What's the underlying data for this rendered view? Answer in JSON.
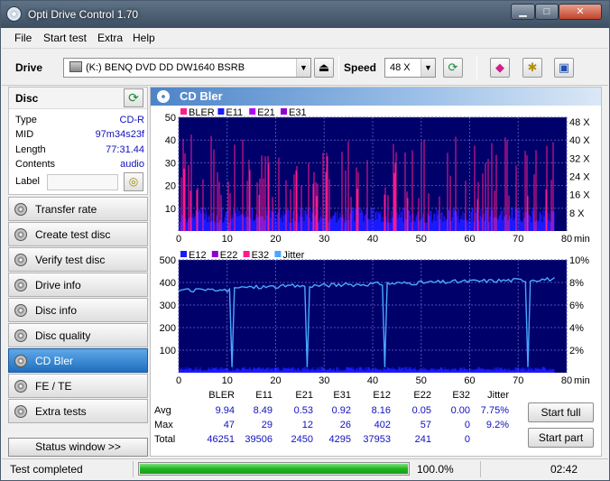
{
  "window": {
    "title": "Opti Drive Control 1.70"
  },
  "menu": [
    "File",
    "Start test",
    "Extra",
    "Help"
  ],
  "toolbar": {
    "drive_label": "Drive",
    "drive_value": "(K:)   BENQ DVD DD DW1640 BSRB",
    "speed_label": "Speed",
    "speed_value": "48 X"
  },
  "disc": {
    "title": "Disc",
    "rows": [
      {
        "key": "Type",
        "value": "CD-R"
      },
      {
        "key": "MID",
        "value": "97m34s23f"
      },
      {
        "key": "Length",
        "value": "77:31.44"
      },
      {
        "key": "Contents",
        "value": "audio"
      }
    ],
    "label_key": "Label"
  },
  "nav": [
    {
      "label": "Transfer rate",
      "active": false
    },
    {
      "label": "Create test disc",
      "active": false
    },
    {
      "label": "Verify test disc",
      "active": false
    },
    {
      "label": "Drive info",
      "active": false
    },
    {
      "label": "Disc info",
      "active": false
    },
    {
      "label": "Disc quality",
      "active": false
    },
    {
      "label": "CD Bler",
      "active": true
    },
    {
      "label": "FE / TE",
      "active": false
    },
    {
      "label": "Extra tests",
      "active": false
    }
  ],
  "status_window_label": "Status window >>",
  "main": {
    "title": "CD Bler"
  },
  "colors": {
    "chart_bg": "#00006a",
    "grid": "#5050b0",
    "bler": "#ff1a8c",
    "e11": "#1a1aff",
    "e21": "#b000ff",
    "e31": "#9000d0",
    "e12": "#1a1aff",
    "e22": "#9000d0",
    "e32": "#ff1a8c",
    "jitter": "#4aa8ff",
    "accent": "#1f6fc0"
  },
  "chart_data": [
    {
      "type": "bar",
      "legend": [
        "BLER",
        "E11",
        "E21",
        "E31"
      ],
      "x_ticks": [
        0,
        10,
        20,
        30,
        40,
        50,
        60,
        70,
        80
      ],
      "x_unit": "min",
      "xlim": [
        0,
        80
      ],
      "y_ticks": [
        10,
        20,
        30,
        40,
        50
      ],
      "ylim": [
        0,
        50
      ],
      "y2_ticks": [
        "8 X",
        "16 X",
        "24 X",
        "32 X",
        "40 X",
        "48 X"
      ],
      "grid": true
    },
    {
      "type": "bar",
      "legend": [
        "E12",
        "E22",
        "E32",
        "Jitter"
      ],
      "x_ticks": [
        0,
        10,
        20,
        30,
        40,
        50,
        60,
        70,
        80
      ],
      "x_unit": "min",
      "xlim": [
        0,
        80
      ],
      "y_ticks": [
        100,
        200,
        300,
        400,
        500
      ],
      "ylim": [
        0,
        500
      ],
      "y2_ticks": [
        "2%",
        "4%",
        "6%",
        "8%",
        "10%"
      ],
      "y2lim": [
        0,
        10
      ],
      "grid": true
    }
  ],
  "stats": {
    "columns": [
      "BLER",
      "E11",
      "E21",
      "E31",
      "E12",
      "E22",
      "E32",
      "Jitter"
    ],
    "rows": [
      {
        "label": "Avg",
        "values": [
          "9.94",
          "8.49",
          "0.53",
          "0.92",
          "8.16",
          "0.05",
          "0.00",
          "7.75%"
        ]
      },
      {
        "label": "Max",
        "values": [
          "47",
          "29",
          "12",
          "26",
          "402",
          "57",
          "0",
          "9.2%"
        ]
      },
      {
        "label": "Total",
        "values": [
          "46251",
          "39506",
          "2450",
          "4295",
          "37953",
          "241",
          "0",
          ""
        ]
      }
    ]
  },
  "buttons": {
    "start_full": "Start full",
    "start_part": "Start part"
  },
  "status": {
    "text": "Test completed",
    "progress": 100,
    "progress_text": "100.0%",
    "elapsed": "02:42"
  }
}
